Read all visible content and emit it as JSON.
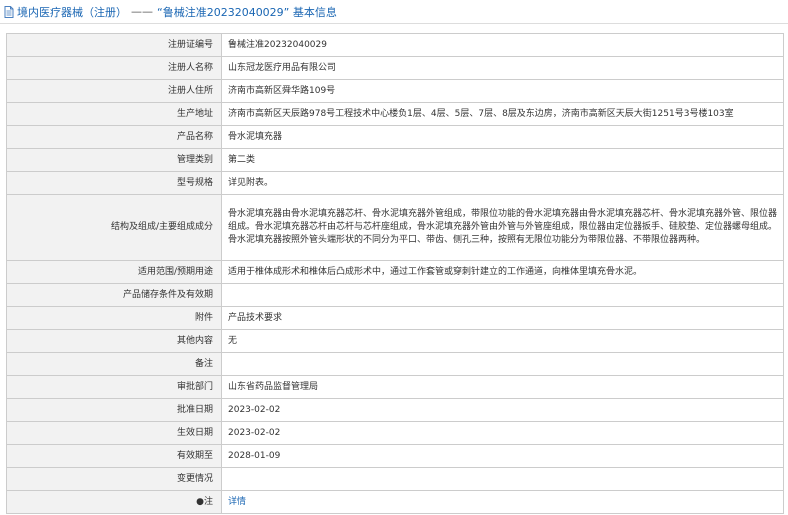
{
  "header": {
    "crumb": "境内医疗器械（注册）",
    "separator": "——",
    "title": "“鲁械注准20232040029” 基本信息"
  },
  "rows": [
    {
      "label": "注册证编号",
      "value": "鲁械注准20232040029"
    },
    {
      "label": "注册人名称",
      "value": "山东冠龙医疗用品有限公司"
    },
    {
      "label": "注册人住所",
      "value": "济南市高新区舜华路109号"
    },
    {
      "label": "生产地址",
      "value": "济南市高新区天辰路978号工程技术中心楼负1层、4层、5层、7层、8层及东边房，济南市高新区天辰大街1251号3号楼103室"
    },
    {
      "label": "产品名称",
      "value": "骨水泥填充器"
    },
    {
      "label": "管理类别",
      "value": "第二类"
    },
    {
      "label": "型号规格",
      "value": "详见附表。"
    },
    {
      "label": "结构及组成/主要组成成分",
      "value": "骨水泥填充器由骨水泥填充器芯杆、骨水泥填充器外管组成，带限位功能的骨水泥填充器由骨水泥填充器芯杆、骨水泥填充器外管、限位器组成。骨水泥填充器芯杆由芯杆与芯杆座组成，骨水泥填充器外管由外管与外管座组成，限位器由定位器扳手、硅胶垫、定位器螺母组成。骨水泥填充器按照外管头端形状的不同分为平口、带齿、侧孔三种，按照有无限位功能分为带限位器、不带限位器两种。"
    },
    {
      "label": "适用范围/预期用途",
      "value": "适用于椎体成形术和椎体后凸成形术中，通过工作套管或穿刺针建立的工作通道，向椎体里填充骨水泥。"
    },
    {
      "label": "产品储存条件及有效期",
      "value": ""
    },
    {
      "label": "附件",
      "value": "产品技术要求"
    },
    {
      "label": "其他内容",
      "value": "无"
    },
    {
      "label": "备注",
      "value": ""
    },
    {
      "label": "审批部门",
      "value": "山东省药品监督管理局"
    },
    {
      "label": "批准日期",
      "value": "2023-02-02"
    },
    {
      "label": "生效日期",
      "value": "2023-02-02"
    },
    {
      "label": "有效期至",
      "value": "2028-01-09"
    },
    {
      "label": "变更情况",
      "value": ""
    },
    {
      "label": "●注",
      "value": "详情"
    }
  ]
}
